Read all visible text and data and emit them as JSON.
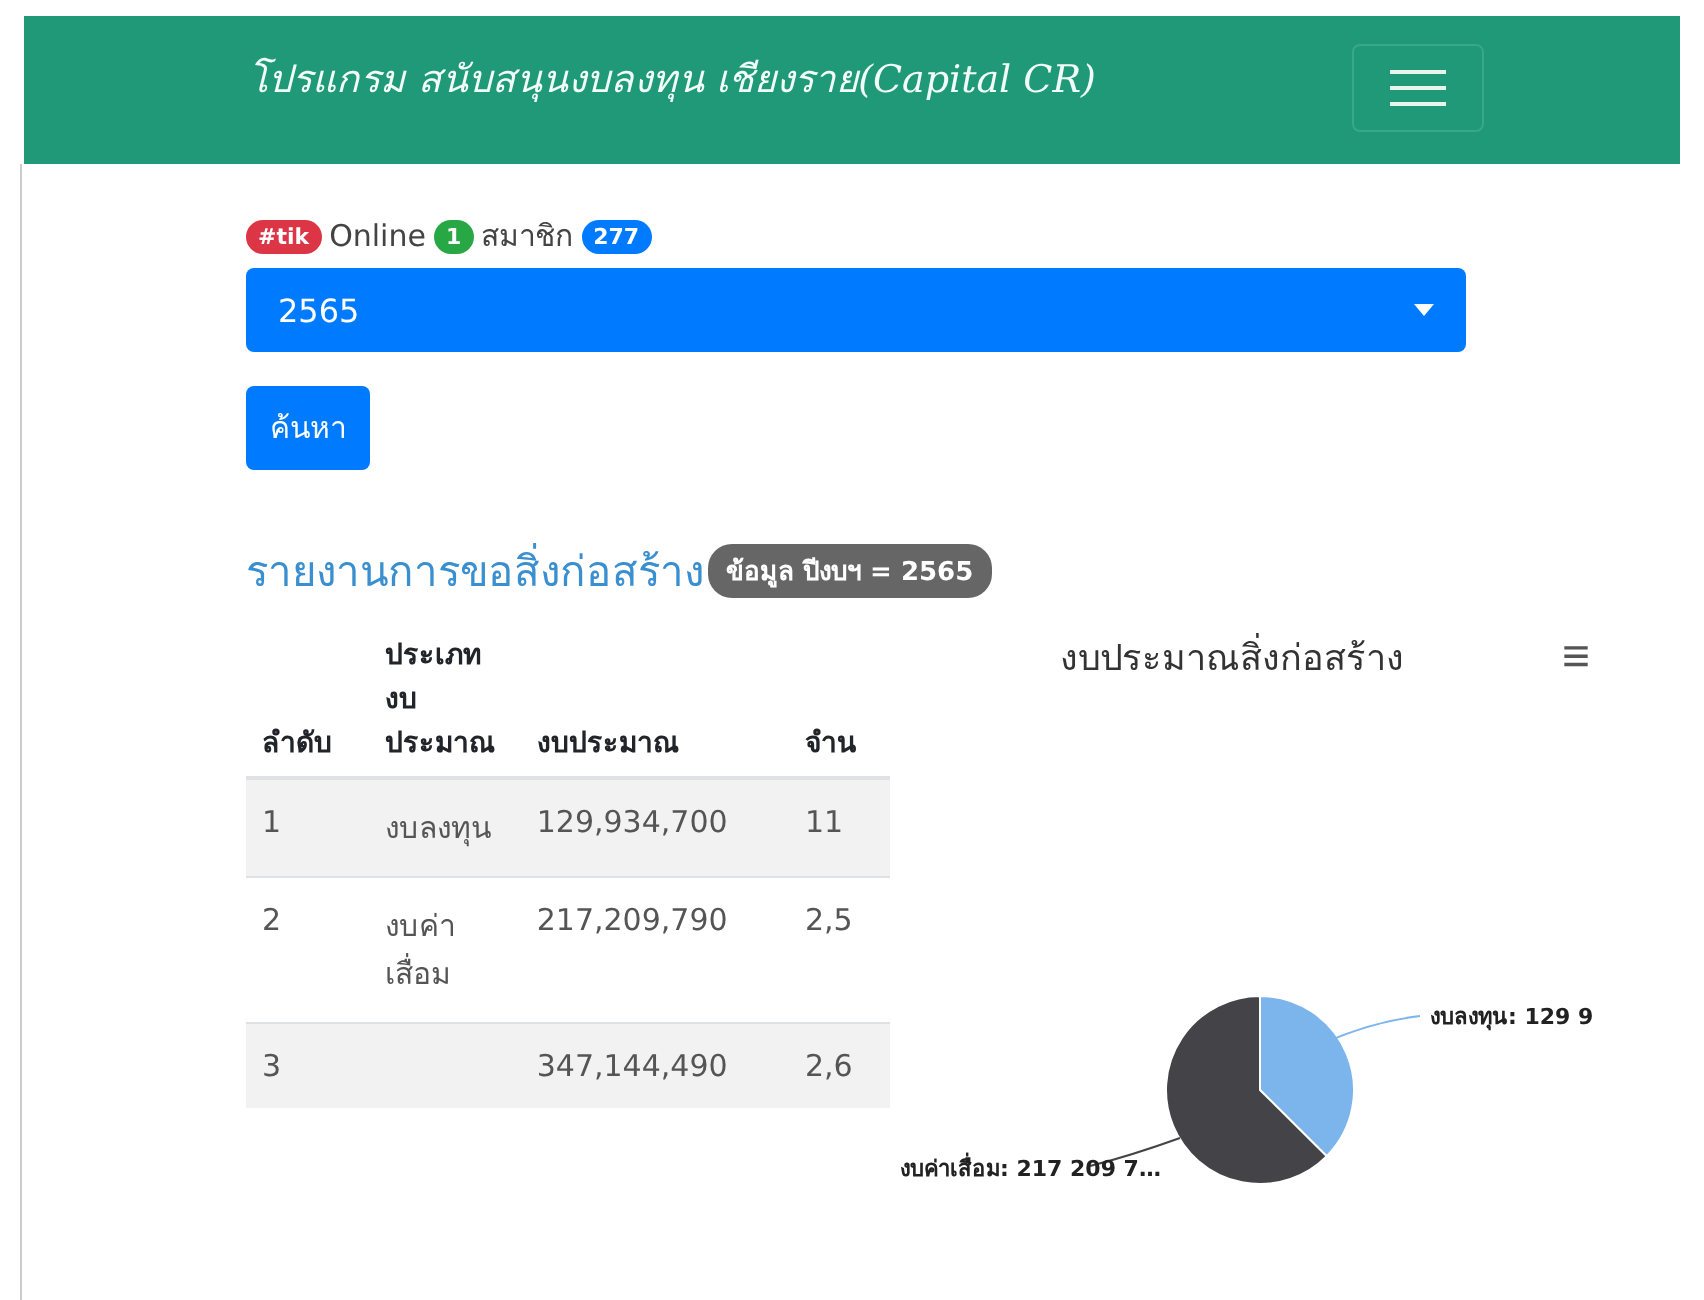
{
  "navbar": {
    "title": "โปรแกรม สนับสนุนงบลงทุน เชียงราย(Capital CR)"
  },
  "status": {
    "tag": "#tik",
    "online_label": "Online",
    "online_count": "1",
    "members_label": "สมาชิก",
    "members_count": "277"
  },
  "year_select": {
    "value": "2565"
  },
  "search_button": "ค้นหา",
  "report": {
    "title": "รายงานการขอสิ่งก่อสร้าง",
    "badge": "ข้อมูล ปีงบฯ = 2565"
  },
  "table": {
    "columns": [
      "ลำดับ",
      "ประเภทงบประมาณ",
      "งบประมาณ",
      "จำน"
    ],
    "rows": [
      [
        "1",
        "งบลงทุน",
        "129,934,700",
        "11"
      ],
      [
        "2",
        "งบค่าเสื่อม",
        "217,209,790",
        "2,5"
      ],
      [
        "3",
        "",
        "347,144,490",
        "2,6"
      ]
    ]
  },
  "chart": {
    "menu": "≡",
    "slice_labels": [
      "งบลงทุน: 129 9",
      "งบค่าเสื่อม: 217 209 7…"
    ],
    "chart_data": {
      "type": "pie",
      "title": "งบประมาณสิ่งก่อสร้าง",
      "values": [
        37.43,
        62.57
      ],
      "colors": [
        "#7cb5ec",
        "#434348"
      ]
    }
  }
}
